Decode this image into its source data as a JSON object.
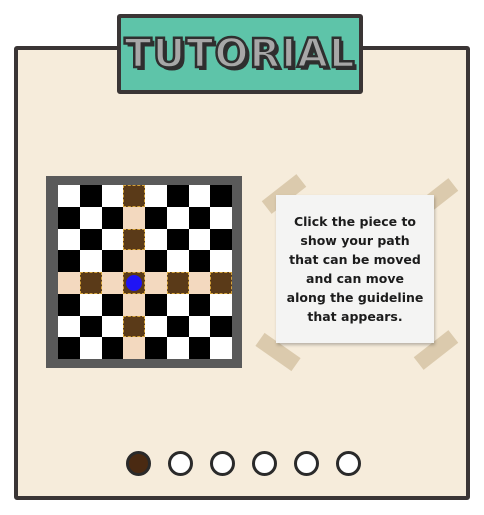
{
  "title": "TUTORIAL",
  "colors": {
    "card_bg": "#f6ecdb",
    "tab_bg": "#5ec4a9",
    "piece": "#1f14f5",
    "guide_light": "#f3d9bf",
    "guide_dark": "#5a3a18",
    "active_dot": "#4a2a12"
  },
  "board": {
    "size": 8,
    "piece_row": 4,
    "piece_col": 3
  },
  "instruction": "Click the piece to\nshow your path\nthat can be moved\nand can move\nalong the guideline\nthat appears.",
  "pagination": {
    "total": 6,
    "current": 1
  }
}
